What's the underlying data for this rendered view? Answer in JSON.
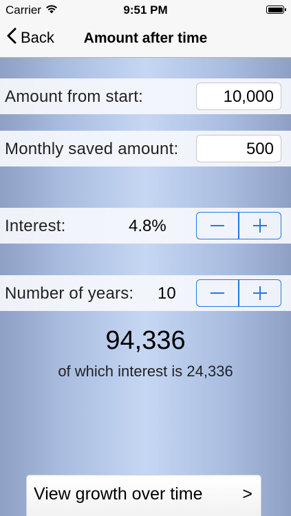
{
  "status_bar": {
    "carrier": "Carrier",
    "time": "9:51 PM"
  },
  "nav": {
    "back_label": "Back",
    "title": "Amount after time"
  },
  "form": {
    "start_amount": {
      "label": "Amount from start:",
      "value": "10,000"
    },
    "monthly_amount": {
      "label": "Monthly saved amount:",
      "value": "500"
    },
    "interest": {
      "label": "Interest:",
      "value": "4.8%"
    },
    "years": {
      "label": "Number of years:",
      "value": "10"
    }
  },
  "result": {
    "total": "94,336",
    "interest_text": "of which interest is 24,336"
  },
  "growth_button": {
    "label": "View growth over time",
    "chevron": ">"
  },
  "colors": {
    "accent": "#2179e4",
    "background_center": "#c6d7f3",
    "background_edge": "#8ea0c3"
  },
  "icons": {
    "wifi": "wifi-icon",
    "battery": "battery-icon",
    "back": "chevron-left-icon",
    "minus": "minus-icon",
    "plus": "plus-icon"
  }
}
